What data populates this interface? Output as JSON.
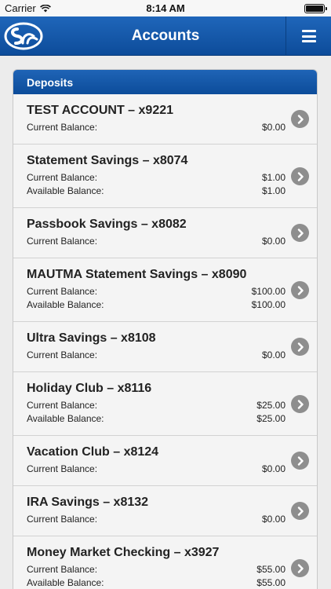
{
  "status_bar": {
    "carrier": "Carrier",
    "time": "8:14 AM"
  },
  "nav": {
    "title": "Accounts"
  },
  "section": {
    "title": "Deposits"
  },
  "balance_labels": {
    "current": "Current Balance:",
    "available": "Available Balance:"
  },
  "accounts": [
    {
      "name": "TEST ACCOUNT – x9221",
      "current": "$0.00"
    },
    {
      "name": "Statement Savings – x8074",
      "current": "$1.00",
      "available": "$1.00"
    },
    {
      "name": "Passbook Savings – x8082",
      "current": "$0.00"
    },
    {
      "name": "MAUTMA Statement Savings – x8090",
      "current": "$100.00",
      "available": "$100.00"
    },
    {
      "name": "Ultra Savings – x8108",
      "current": "$0.00"
    },
    {
      "name": "Holiday Club – x8116",
      "current": "$25.00",
      "available": "$25.00"
    },
    {
      "name": "Vacation Club – x8124",
      "current": "$0.00"
    },
    {
      "name": "IRA Savings – x8132",
      "current": "$0.00"
    },
    {
      "name": "Money Market Checking – x3927",
      "current": "$55.00",
      "available": "$55.00"
    }
  ],
  "colors": {
    "nav_blue": "#1459ab",
    "chevron_gray": "#8e8e8e"
  }
}
